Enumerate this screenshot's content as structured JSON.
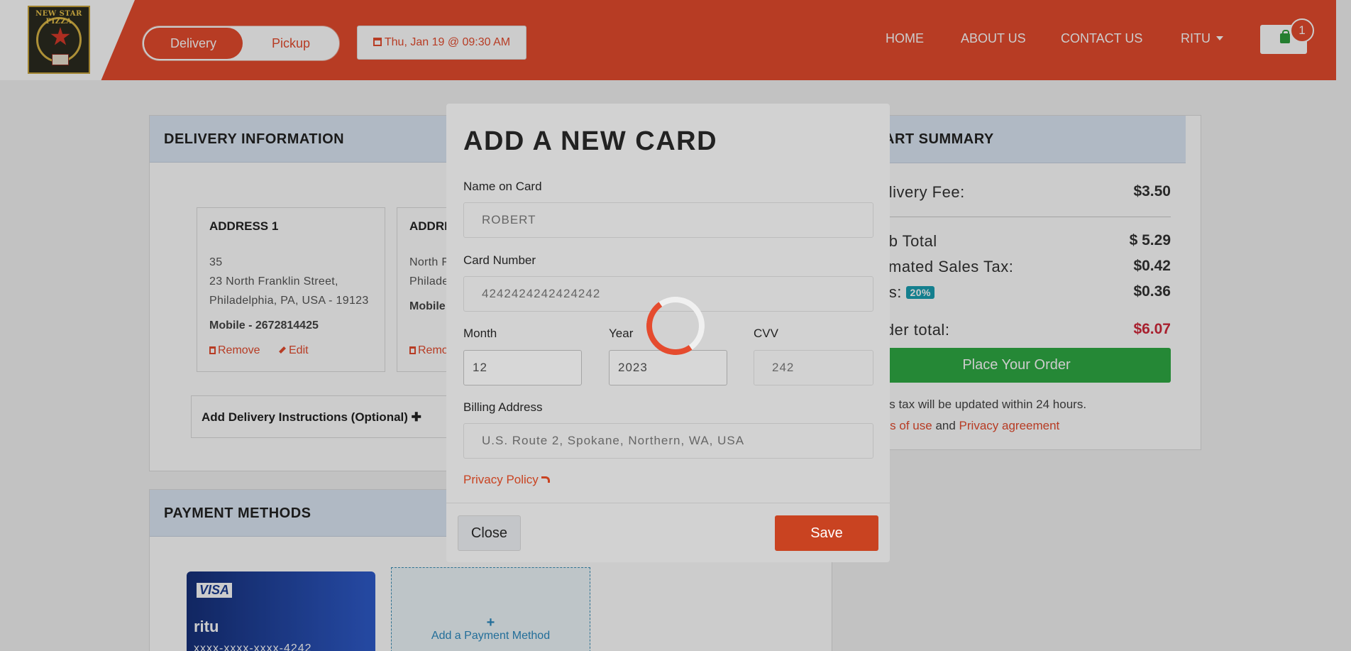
{
  "header": {
    "logo_text": "NEW STAR PIZZA",
    "delivery_label": "Delivery",
    "pickup_label": "Pickup",
    "schedule": "Thu, Jan 19 @ 09:30 AM",
    "nav": [
      "HOME",
      "ABOUT US",
      "CONTACT US",
      "RITU"
    ],
    "cart_count": "1"
  },
  "delivery": {
    "title": "DELIVERY INFORMATION",
    "addresses": [
      {
        "title": "ADDRESS 1",
        "line1": "35",
        "line2": "23 North Franklin Street,",
        "line3": "Philadelphia, PA, USA - 19123",
        "mobile": "Mobile - 2672814425",
        "remove": "Remove",
        "edit": "Edit"
      },
      {
        "title": "ADDRE",
        "line1": "North F",
        "line2": "Philade",
        "mobile": "Mobile",
        "remove": "Remo"
      }
    ],
    "instructions": "Add Delivery Instructions (Optional) ✚"
  },
  "payment": {
    "title": "PAYMENT METHODS",
    "card_brand": "VISA",
    "card_holder": "ritu",
    "card_number": "xxxx-xxxx-xxxx-4242",
    "add_plus": "+",
    "add_label": "Add a Payment Method"
  },
  "summary": {
    "title": "ART SUMMARY",
    "delivery_fee_label": "elivery Fee:",
    "delivery_fee": "$3.50",
    "subtotal_label": "ub Total",
    "subtotal": "$ 5.29",
    "tax_label": "timated Sales Tax:",
    "tax": "$0.42",
    "tips_label": "ps:",
    "tips_badge": "20%",
    "tips": "$0.36",
    "total_label": "rder total:",
    "total": "$6.07",
    "place_order": "Place Your Order",
    "note1": "les tax will be updated within 24 hours.",
    "terms": "ms of use",
    "and": "and",
    "privacy": "Privacy agreement"
  },
  "modal": {
    "title": "ADD A NEW CARD",
    "name_label": "Name on Card",
    "name_placeholder": "ROBERT",
    "number_label": "Card Number",
    "number_placeholder": "4242424242424242",
    "month_label": "Month",
    "month_value": "12",
    "year_label": "Year",
    "year_value": "2023",
    "cvv_label": "CVV",
    "cvv_placeholder": "242",
    "billing_label": "Billing Address",
    "billing_placeholder": "U.S. Route 2, Spokane, Northern, WA, USA",
    "privacy_link": "Privacy Policy",
    "close_label": "Close",
    "save_label": "Save"
  },
  "colors": {
    "brand": "#e54b2e",
    "success": "#2faa44",
    "info": "#1a9fb2"
  }
}
